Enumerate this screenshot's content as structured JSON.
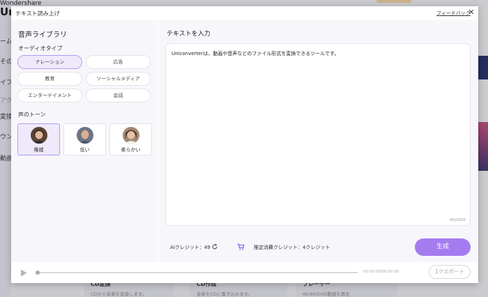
{
  "background_app": {
    "brand_line1": "Wondershare",
    "brand_line2": "Un",
    "sidebar_fragments": [
      "ーム",
      "その他",
      "イフ",
      "アク",
      "変換",
      "ウン",
      "動画"
    ],
    "bottom_cards": [
      {
        "title": "CD変換",
        "desc": "CDから音楽を変換します。"
      },
      {
        "title": "CD作成",
        "desc": "音楽をCDに書き込みます。"
      },
      {
        "title": "プレーヤー",
        "desc": "4K/8KのHD動画を再生"
      }
    ]
  },
  "dialog": {
    "title": "テキスト読み上げ",
    "feedback_label": "フィードバック",
    "close_glyph": "✕"
  },
  "library": {
    "title": "音声ライブラリ",
    "audio_type_label": "オーディオタイプ",
    "types": [
      {
        "label": "ナレーション",
        "selected": true
      },
      {
        "label": "広告",
        "selected": false
      },
      {
        "label": "教育",
        "selected": false
      },
      {
        "label": "ソーシャルメディア",
        "selected": false
      },
      {
        "label": "エンターテイメント",
        "selected": false
      },
      {
        "label": "会話",
        "selected": false
      }
    ],
    "tone_label": "声のトーン",
    "tones": [
      {
        "label": "権威",
        "selected": true
      },
      {
        "label": "低い",
        "selected": false
      },
      {
        "label": "柔らかい",
        "selected": false
      }
    ]
  },
  "editor": {
    "title": "テキストを入力",
    "text": "Uniconverterは、動画や音声などのファイル形式を変換できるツールです。",
    "char_counter": "40/2000",
    "ai_credit": "AIクレジット：49",
    "estimated_credit": "推定消費クレジット：4クレジット",
    "generate_label": "生成"
  },
  "player": {
    "time": "00:00:00/00:00:00",
    "progress": 0,
    "export_label": "1クスポート"
  },
  "colors": {
    "accent": "#a47cf0",
    "selected_bg": "#efe9fb",
    "selected_border": "#b49cf0"
  }
}
